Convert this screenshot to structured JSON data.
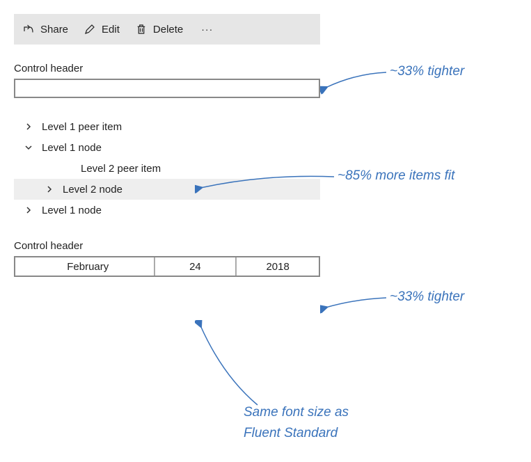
{
  "cmdbar": {
    "share_label": "Share",
    "edit_label": "Edit",
    "delete_label": "Delete",
    "more_glyph": "···"
  },
  "textbox_section": {
    "header": "Control header",
    "value": ""
  },
  "tree": {
    "items": [
      {
        "label": "Level 1 peer item"
      },
      {
        "label": "Level 1 node"
      },
      {
        "label": "Level 2 peer item"
      },
      {
        "label": "Level 2 node"
      },
      {
        "label": "Level 1 node"
      }
    ]
  },
  "date_section": {
    "header": "Control header",
    "month": "February",
    "day": "24",
    "year": "2018"
  },
  "annotations": {
    "tighter1": "~33% tighter",
    "more_items": "~85% more items fit",
    "tighter2": "~33% tighter",
    "fontsize_line1": "Same font size as",
    "fontsize_line2": "Fluent Standard"
  }
}
